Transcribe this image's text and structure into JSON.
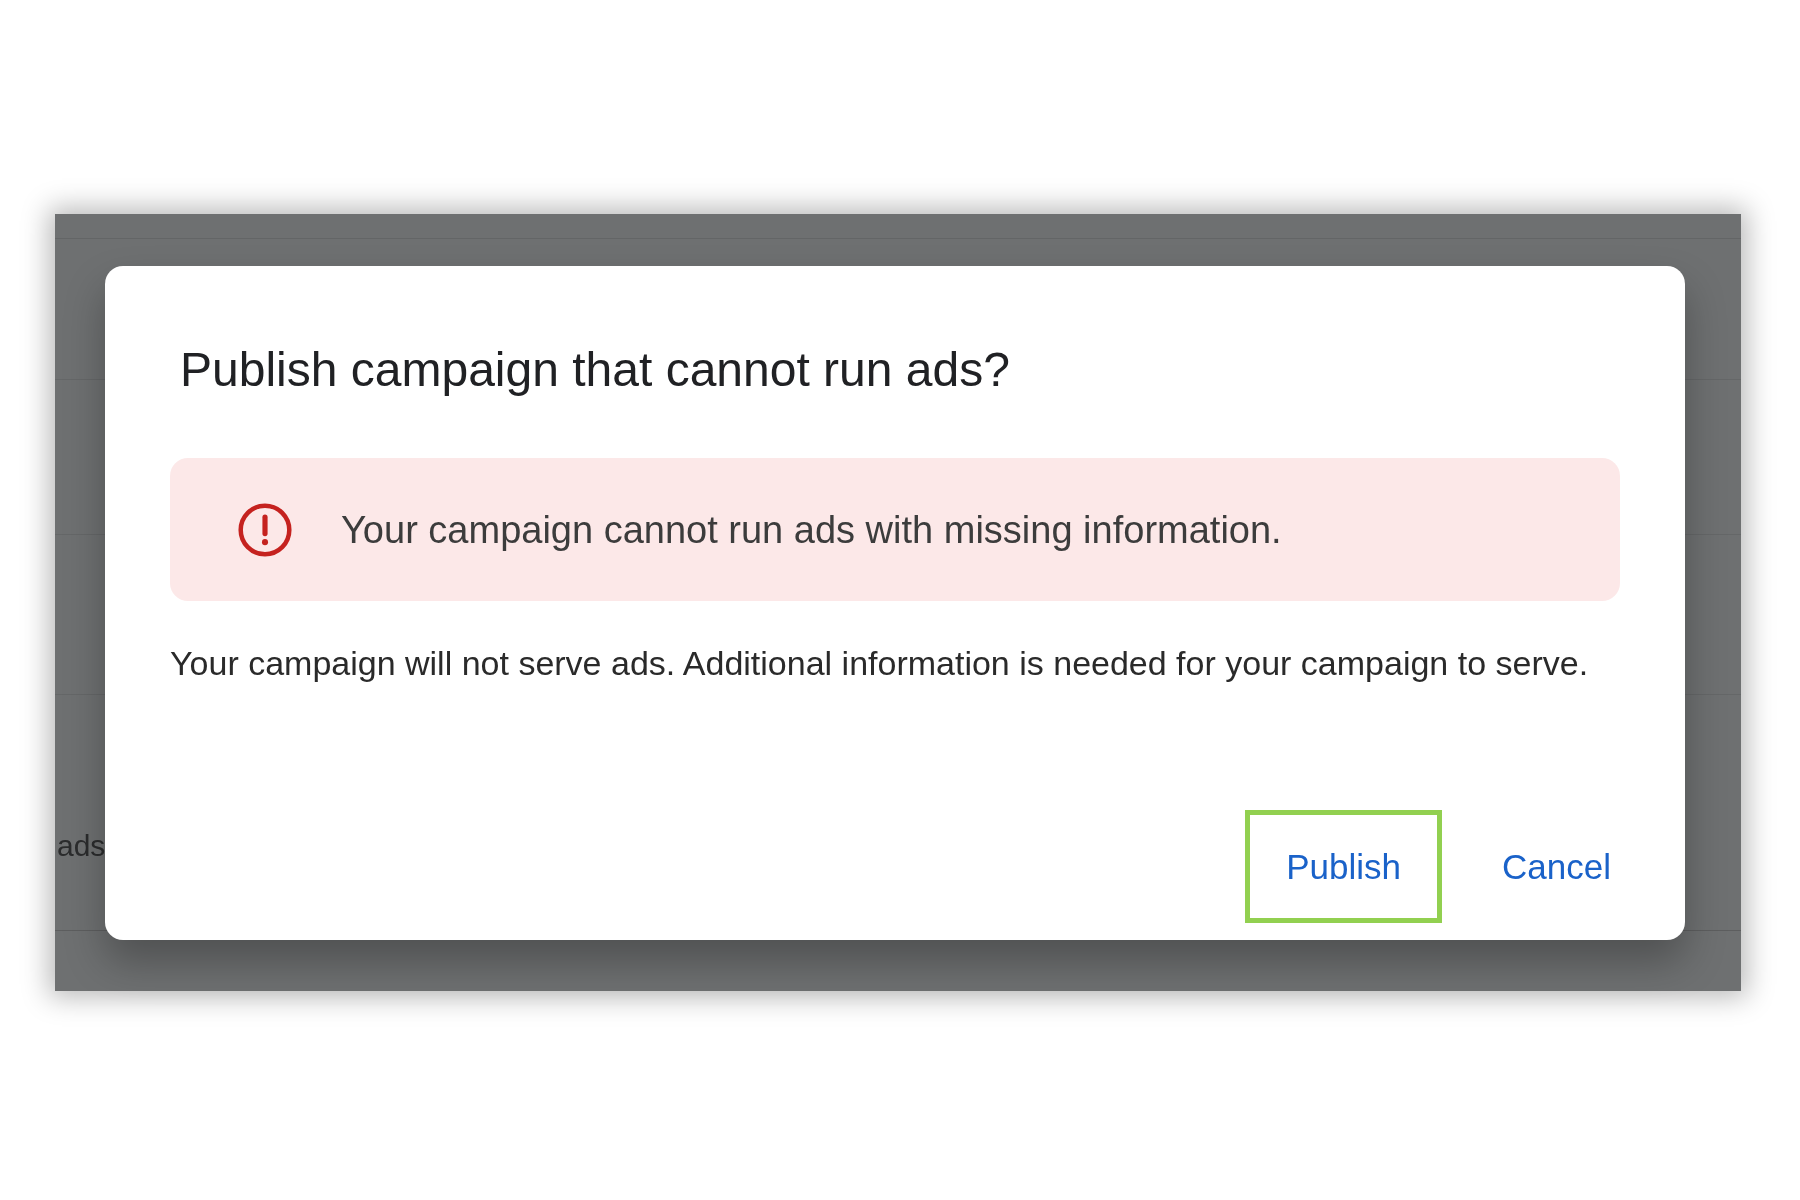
{
  "background": {
    "fragment_text": "ads"
  },
  "dialog": {
    "title": "Publish campaign that cannot run ads?",
    "alert": {
      "kind": "error",
      "message": "Your campaign cannot run ads with missing information."
    },
    "body": "Your campaign will not serve ads. Additional information is needed for your campaign to serve.",
    "buttons": [
      {
        "label": "Publish",
        "highlighted": true
      },
      {
        "label": "Cancel",
        "highlighted": false
      }
    ]
  }
}
